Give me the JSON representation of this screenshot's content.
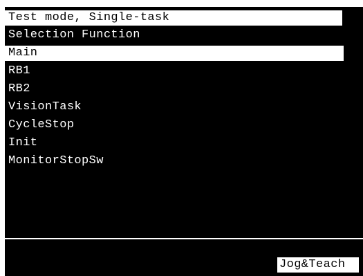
{
  "header": {
    "title": "Test mode, Single-task",
    "subtitle": "Selection Function"
  },
  "tasks": {
    "selected": "Main",
    "items": [
      {
        "label": "Main"
      },
      {
        "label": "RB1"
      },
      {
        "label": "RB2"
      },
      {
        "label": "VisionTask"
      },
      {
        "label": "CycleStop"
      },
      {
        "label": "Init"
      },
      {
        "label": "MonitorStopSw"
      }
    ]
  },
  "softkeys": {
    "jog_teach": "Jog&Teach"
  },
  "colors": {
    "background": "#000000",
    "foreground": "#ffffff",
    "highlight_bg": "#ffffff",
    "highlight_fg": "#000000"
  }
}
